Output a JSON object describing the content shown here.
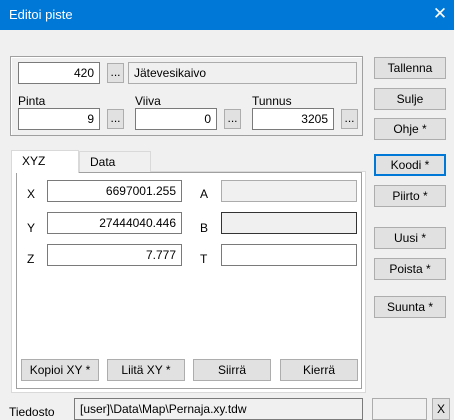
{
  "window": {
    "title": "Editoi piste",
    "close_glyph": "✕"
  },
  "top": {
    "code_value": "420",
    "code_desc": "Jätevesikaivo",
    "dots": "...",
    "pinta_label": "Pinta",
    "pinta_value": "9",
    "viiva_label": "Viiva",
    "viiva_value": "0",
    "tunnus_label": "Tunnus",
    "tunnus_value": "3205"
  },
  "right_buttons": {
    "tallenna": "Tallenna",
    "sulje": "Sulje",
    "ohje": "Ohje *",
    "koodi": "Koodi *",
    "piirto": "Piirto *",
    "uusi": "Uusi *",
    "poista": "Poista *",
    "suunta": "Suunta *"
  },
  "tabs": {
    "xyz": "XYZ",
    "data": "Data"
  },
  "coords": {
    "x_label": "X",
    "x_value": "6697001.255",
    "y_label": "Y",
    "y_value": "27444040.446",
    "z_label": "Z",
    "z_value": "7.777",
    "a_label": "A",
    "a_value": "",
    "b_label": "B",
    "b_value": "",
    "t_label": "T",
    "t_value": ""
  },
  "bottom_buttons": {
    "kopioi": "Kopioi XY *",
    "liita": "Liitä XY *",
    "siirra": "Siirrä",
    "kierra": "Kierrä"
  },
  "file": {
    "label": "Tiedosto",
    "path": "[user]\\Data\\Map\\Pernaja.xy.tdw",
    "small_btn": "X"
  },
  "colors": {
    "titlebar": "#0078d7",
    "focus_border": "#0078d7"
  }
}
